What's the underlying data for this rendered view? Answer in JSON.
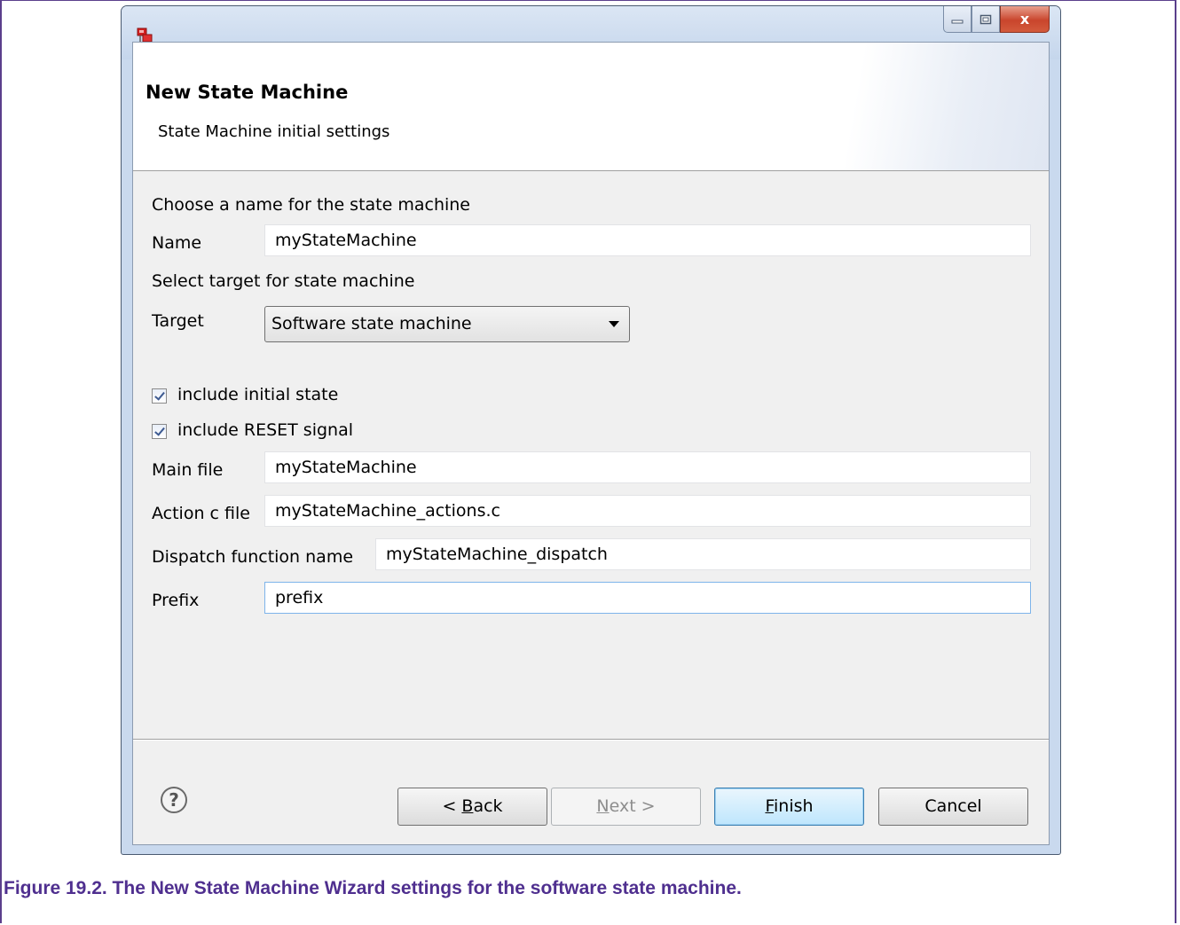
{
  "window": {
    "minimize_glyph": "—",
    "maximize_glyph": "□",
    "close_glyph": "x"
  },
  "header": {
    "title": "New State Machine",
    "subtitle": "State Machine initial settings"
  },
  "form": {
    "name_prompt": "Choose a name for the state machine",
    "name_label": "Name",
    "name_value": "myStateMachine",
    "target_prompt": "Select target for state machine",
    "target_label": "Target",
    "target_value": "Software state machine",
    "include_initial_label": "include initial state",
    "include_initial_checked": true,
    "include_reset_label": "include RESET signal",
    "include_reset_checked": true,
    "main_file_label": "Main file",
    "main_file_value": "myStateMachine",
    "action_file_label": "Action c file",
    "action_file_value": "myStateMachine_actions.c",
    "dispatch_label": "Dispatch function name",
    "dispatch_value": "myStateMachine_dispatch",
    "prefix_label": "Prefix",
    "prefix_value": "prefix"
  },
  "footer": {
    "help_icon": "help-icon",
    "back": {
      "pre": "< ",
      "mnemonic": "B",
      "post": "ack"
    },
    "next": {
      "pre": "",
      "mnemonic": "N",
      "post": "ext >"
    },
    "finish": {
      "pre": "",
      "mnemonic": "F",
      "post": "inish"
    },
    "cancel": "Cancel"
  },
  "caption": "Figure 19.2. The New State Machine Wizard settings for the software state machine.",
  "colors": {
    "caption": "#4f2f8f",
    "frame": "#5b3f8c",
    "close_button": "#c9452c"
  }
}
